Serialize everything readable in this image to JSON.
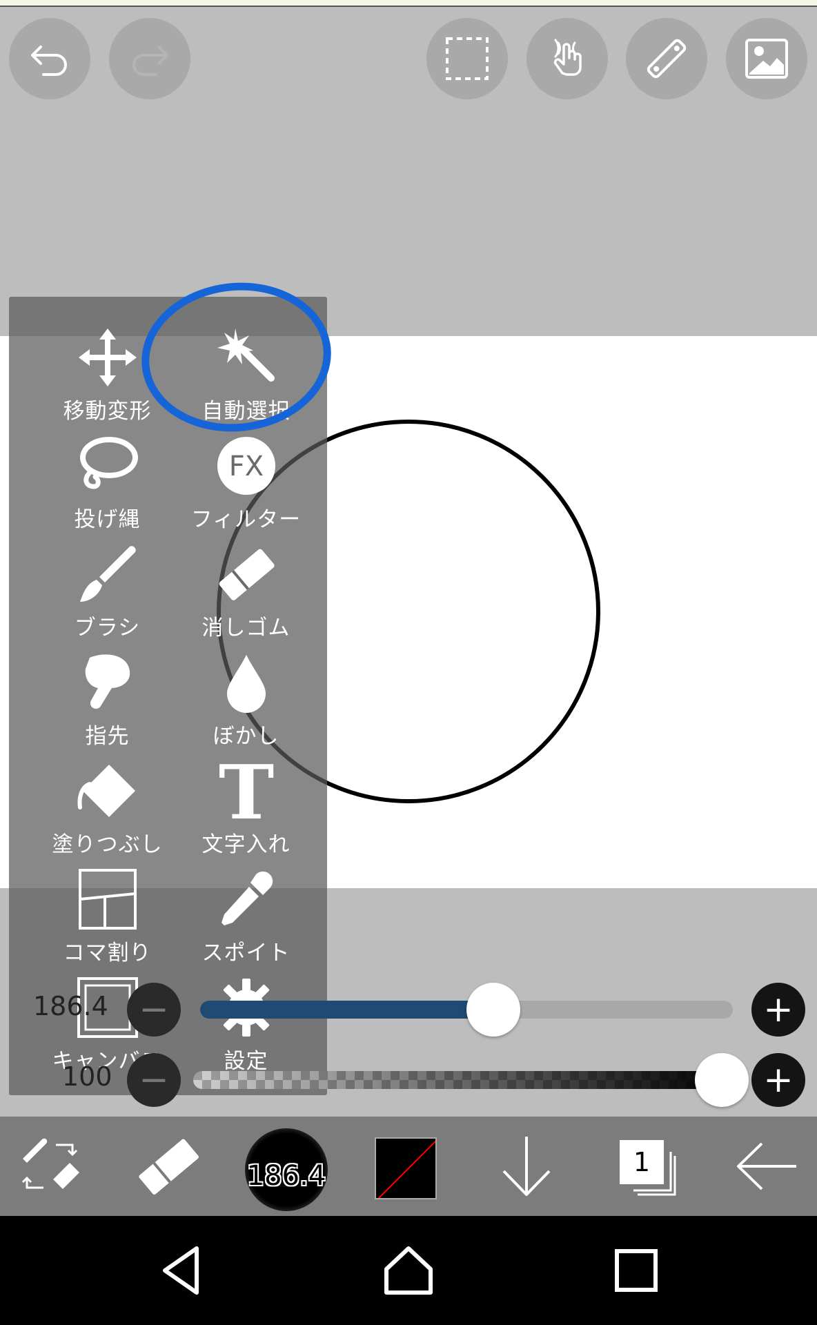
{
  "tools": [
    {
      "key": "move",
      "label": "移動変形",
      "icon": "move-arrows-icon"
    },
    {
      "key": "magic",
      "label": "自動選択",
      "icon": "magic-wand-icon"
    },
    {
      "key": "lasso",
      "label": "投げ縄",
      "icon": "lasso-icon"
    },
    {
      "key": "filter",
      "label": "フィルター",
      "icon": "fx-icon",
      "badge": "FX"
    },
    {
      "key": "brush",
      "label": "ブラシ",
      "icon": "brush-icon"
    },
    {
      "key": "eraser",
      "label": "消しゴム",
      "icon": "eraser-icon"
    },
    {
      "key": "finger",
      "label": "指先",
      "icon": "finger-icon"
    },
    {
      "key": "blur",
      "label": "ぼかし",
      "icon": "drop-icon"
    },
    {
      "key": "fill",
      "label": "塗りつぶし",
      "icon": "bucket-icon"
    },
    {
      "key": "text",
      "label": "文字入れ",
      "icon": "text-icon",
      "glyph": "T"
    },
    {
      "key": "frame",
      "label": "コマ割り",
      "icon": "frame-divider-icon"
    },
    {
      "key": "eyedropper",
      "label": "スポイト",
      "icon": "eyedropper-icon"
    },
    {
      "key": "canvas",
      "label": "キャンバス",
      "icon": "canvas-icon"
    },
    {
      "key": "settings",
      "label": "設定",
      "icon": "gear-icon"
    }
  ],
  "size_slider": {
    "value_text": "186.4",
    "fraction": 0.55,
    "minus": "−",
    "plus": "+"
  },
  "opacity_slider": {
    "value_text": "100",
    "fraction": 1.0,
    "minus": "−",
    "plus": "+"
  },
  "toolbar": {
    "brush_size": "186.4",
    "layer_count": "1"
  },
  "colors": {
    "highlight": "#1565d8",
    "slider_fill": "#1e4a73",
    "swatch_slash": "#ff0000"
  }
}
